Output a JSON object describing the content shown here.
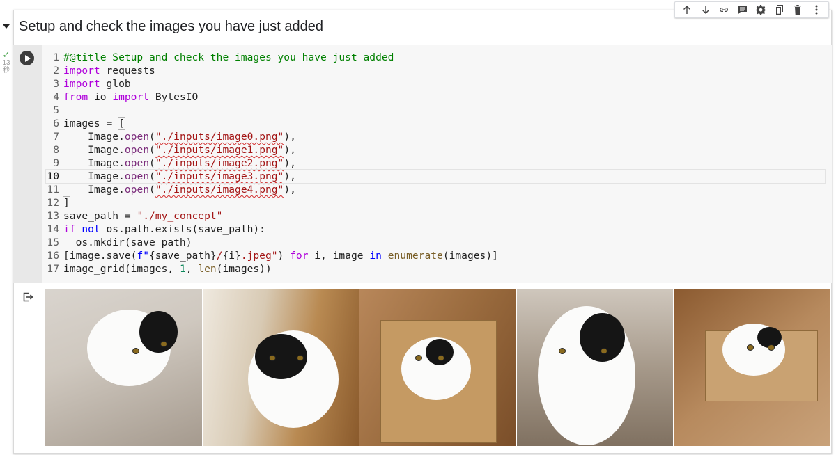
{
  "section": {
    "title": "Setup and check the images you have just added"
  },
  "status": {
    "execution_time": "13\n秒"
  },
  "toolbar": {
    "buttons": [
      "move-up",
      "move-down",
      "link",
      "comment",
      "settings",
      "mirror-cell",
      "delete",
      "more"
    ]
  },
  "code": {
    "lines": [
      {
        "n": "1",
        "tokens": [
          {
            "t": "#@title Setup and check the images you have just added",
            "c": "cm"
          }
        ]
      },
      {
        "n": "2",
        "tokens": [
          {
            "t": "import",
            "c": "kw"
          },
          {
            "t": " requests",
            "c": ""
          }
        ]
      },
      {
        "n": "3",
        "tokens": [
          {
            "t": "import",
            "c": "kw"
          },
          {
            "t": " glob",
            "c": ""
          }
        ]
      },
      {
        "n": "4",
        "tokens": [
          {
            "t": "from",
            "c": "kw"
          },
          {
            "t": " io ",
            "c": ""
          },
          {
            "t": "import",
            "c": "kw"
          },
          {
            "t": " BytesIO",
            "c": ""
          }
        ]
      },
      {
        "n": "5",
        "tokens": []
      },
      {
        "n": "6",
        "tokens": [
          {
            "t": "images = ",
            "c": ""
          },
          {
            "t": "[",
            "c": "bk"
          }
        ]
      },
      {
        "n": "7",
        "tokens": [
          {
            "t": "    Image.",
            "c": ""
          },
          {
            "t": "open",
            "c": "at"
          },
          {
            "t": "(",
            "c": ""
          },
          {
            "t": "\"./inputs/image0.png\"",
            "c": "st sq"
          },
          {
            "t": "),",
            "c": ""
          }
        ]
      },
      {
        "n": "8",
        "tokens": [
          {
            "t": "    Image.",
            "c": ""
          },
          {
            "t": "open",
            "c": "at"
          },
          {
            "t": "(",
            "c": ""
          },
          {
            "t": "\"./inputs/image1.png\"",
            "c": "st sq"
          },
          {
            "t": "),",
            "c": ""
          }
        ]
      },
      {
        "n": "9",
        "tokens": [
          {
            "t": "    Image.",
            "c": ""
          },
          {
            "t": "open",
            "c": "at"
          },
          {
            "t": "(",
            "c": ""
          },
          {
            "t": "\"./inputs/image2.png\"",
            "c": "st sq"
          },
          {
            "t": "),",
            "c": ""
          }
        ]
      },
      {
        "n": "10",
        "tokens": [
          {
            "t": "    Image.",
            "c": ""
          },
          {
            "t": "open",
            "c": "at"
          },
          {
            "t": "(",
            "c": ""
          },
          {
            "t": "\"./inputs/image3.png\"",
            "c": "st sq"
          },
          {
            "t": "),",
            "c": ""
          }
        ]
      },
      {
        "n": "11",
        "tokens": [
          {
            "t": "    Image.",
            "c": ""
          },
          {
            "t": "open",
            "c": "at"
          },
          {
            "t": "(",
            "c": ""
          },
          {
            "t": "\"./inputs/image4.png\"",
            "c": "st sq"
          },
          {
            "t": "),",
            "c": ""
          }
        ]
      },
      {
        "n": "12",
        "tokens": [
          {
            "t": "]",
            "c": "bk"
          }
        ]
      },
      {
        "n": "13",
        "tokens": [
          {
            "t": "save_path = ",
            "c": ""
          },
          {
            "t": "\"./my_concept\"",
            "c": "st"
          }
        ]
      },
      {
        "n": "14",
        "tokens": [
          {
            "t": "if",
            "c": "kw"
          },
          {
            "t": " ",
            "c": ""
          },
          {
            "t": "not",
            "c": "kw2"
          },
          {
            "t": " os.path.exists(save_path):",
            "c": ""
          }
        ]
      },
      {
        "n": "15",
        "tokens": [
          {
            "t": "  os.mkdir(save_path)",
            "c": ""
          }
        ]
      },
      {
        "n": "16",
        "tokens": [
          {
            "t": "[image.save(",
            "c": ""
          },
          {
            "t": "f\"",
            "c": "kw2"
          },
          {
            "t": "{save_path}",
            "c": ""
          },
          {
            "t": "/",
            "c": "st"
          },
          {
            "t": "{i}",
            "c": ""
          },
          {
            "t": ".jpeg\"",
            "c": "st"
          },
          {
            "t": ") ",
            "c": ""
          },
          {
            "t": "for",
            "c": "kw"
          },
          {
            "t": " i, image ",
            "c": ""
          },
          {
            "t": "in",
            "c": "kw2"
          },
          {
            "t": " ",
            "c": ""
          },
          {
            "t": "enumerate",
            "c": "fn"
          },
          {
            "t": "(images)]",
            "c": ""
          }
        ]
      },
      {
        "n": "17",
        "tokens": [
          {
            "t": "image_grid(images, ",
            "c": ""
          },
          {
            "t": "1",
            "c": "nm"
          },
          {
            "t": ", ",
            "c": ""
          },
          {
            "t": "len",
            "c": "fn"
          },
          {
            "t": "(images))",
            "c": ""
          }
        ]
      }
    ],
    "active_line": "10"
  },
  "output": {
    "photos": [
      "cat-on-radiator",
      "cat-by-pillar",
      "cat-on-cardboard-box",
      "cat-portrait",
      "cat-in-box"
    ]
  }
}
